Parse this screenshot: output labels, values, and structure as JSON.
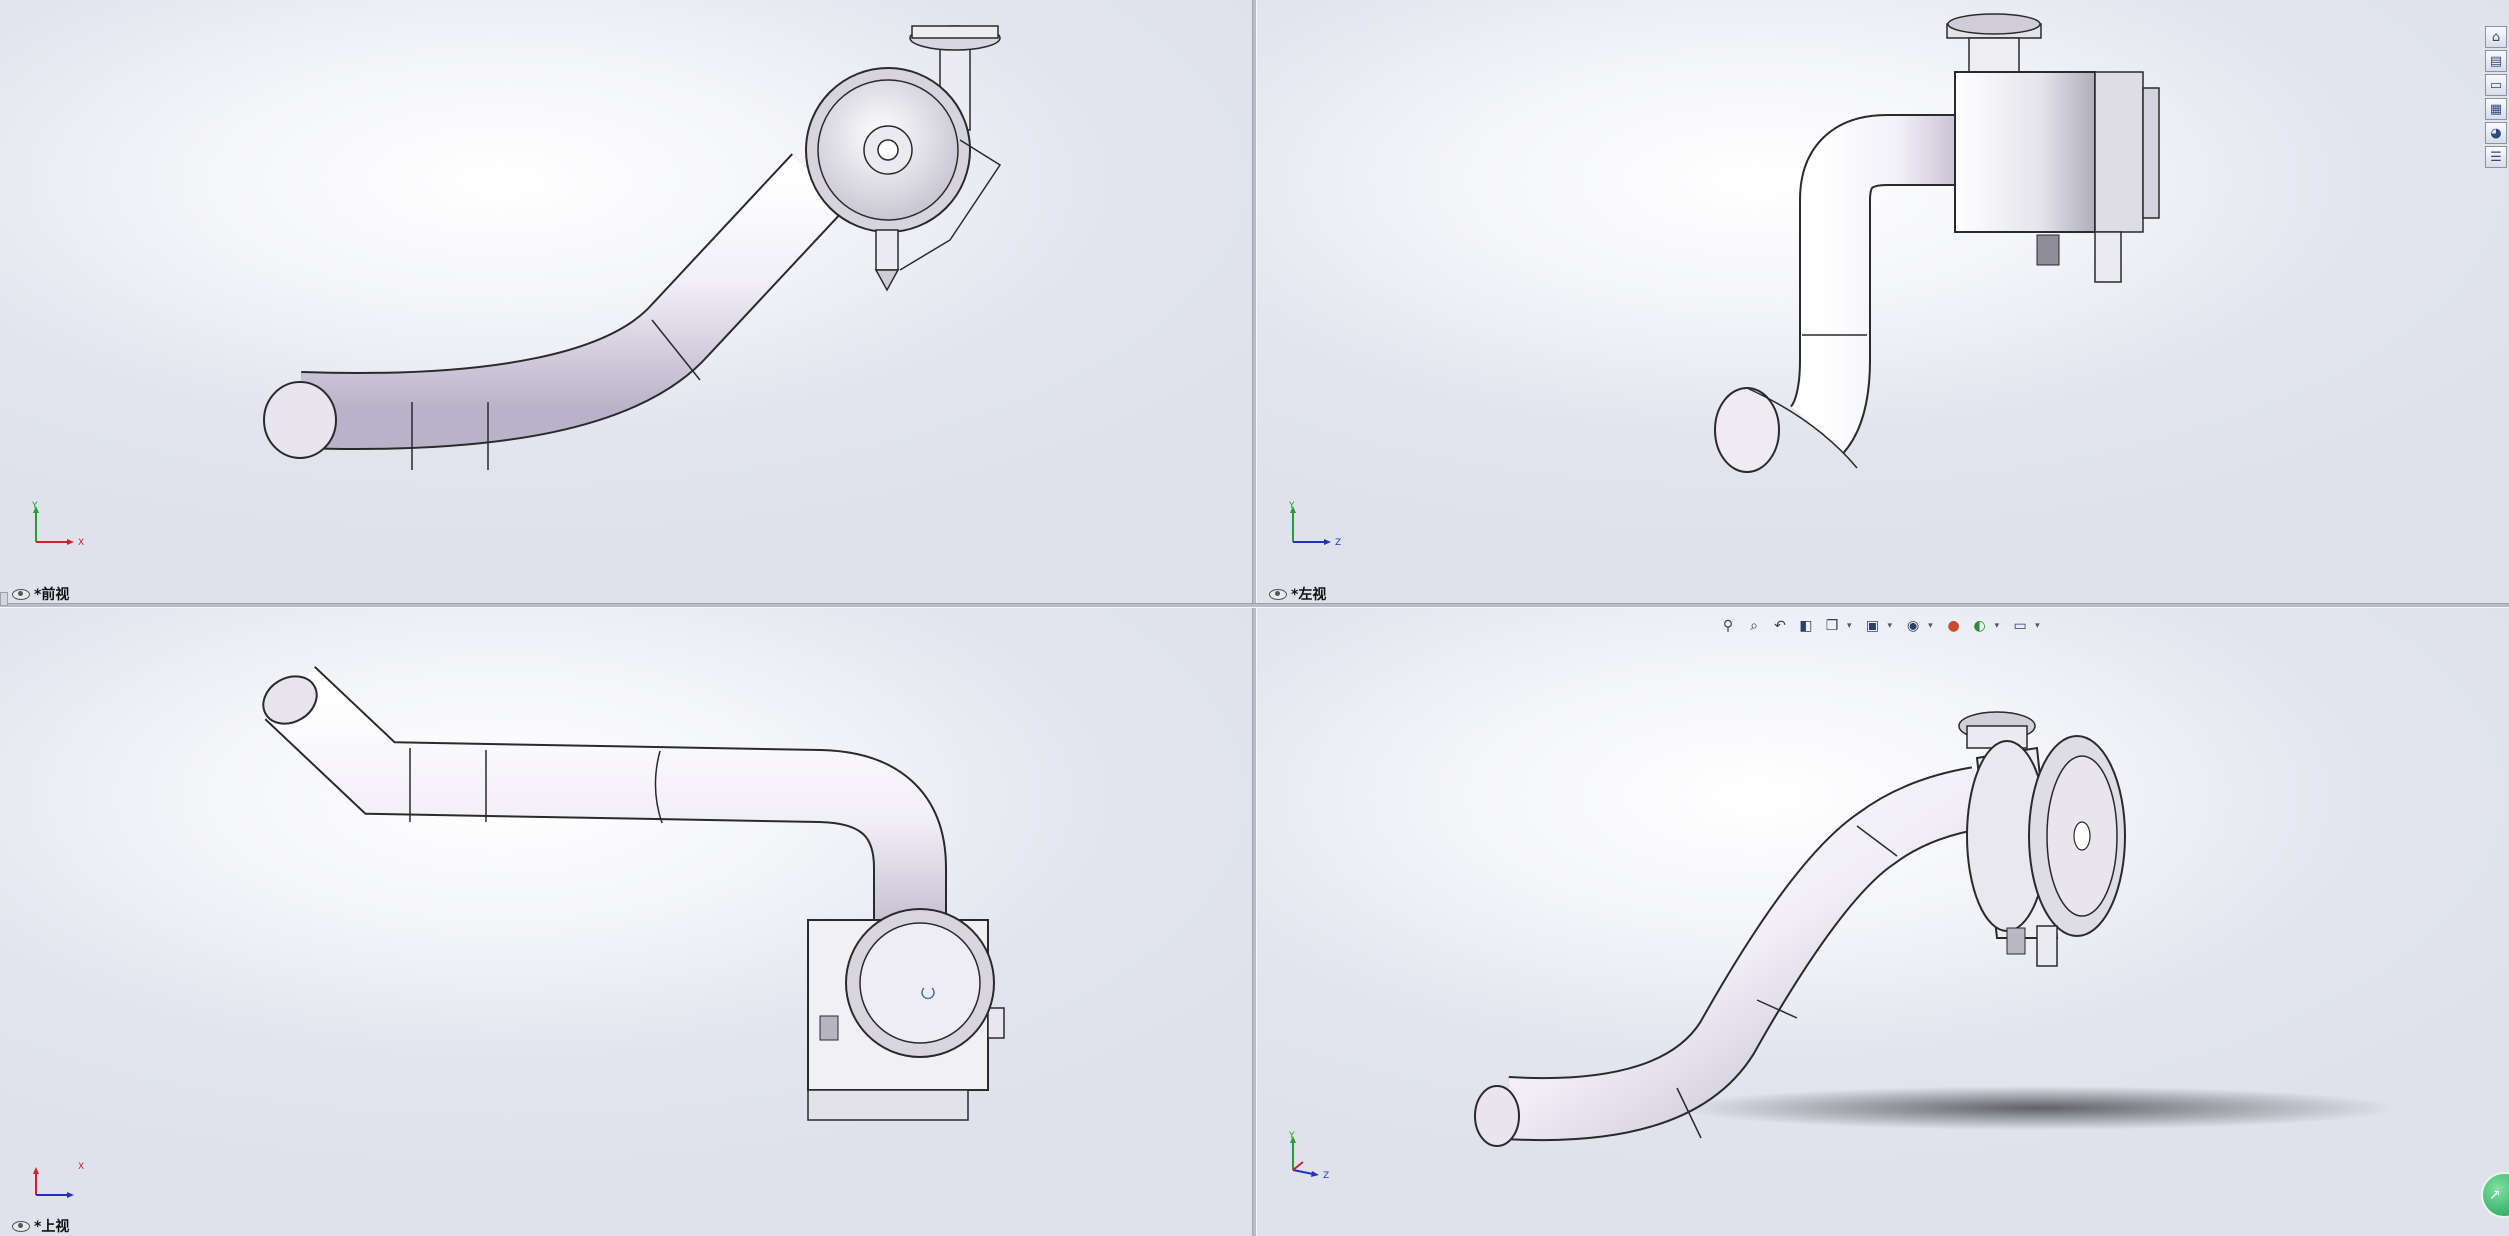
{
  "viewports": {
    "front": {
      "label": "*前视"
    },
    "left": {
      "label": "*左视"
    },
    "top": {
      "label": "*上视"
    },
    "iso": {
      "label": ""
    }
  },
  "triads": {
    "front": {
      "axis_h": "X",
      "axis_v": "Y"
    },
    "left": {
      "axis_h": "Z",
      "axis_v": "Y"
    },
    "top": {
      "axis_h": "X",
      "axis_v": ""
    },
    "iso": {
      "axis_h": "Z",
      "axis_v": "Y"
    }
  },
  "heads_up_toolbar": {
    "icons": [
      "zoom-to-fit-icon",
      "zoom-to-area-icon",
      "previous-view-icon",
      "section-view-icon",
      "view-orientation-icon",
      "display-style-icon",
      "hide-show-items-icon",
      "edit-appearance-icon",
      "apply-scene-icon",
      "view-settings-icon"
    ]
  },
  "task_pane": {
    "icons": [
      "home-icon",
      "design-library-icon",
      "file-explorer-icon",
      "view-palette-icon",
      "appearances-icon",
      "custom-properties-icon"
    ]
  },
  "colors": {
    "pipe_light": "#f6f4fb",
    "pipe_shade": "#bdb6cc",
    "outline": "#2a2a2a",
    "axis_x": "#d0202a",
    "axis_y": "#22a035",
    "axis_z": "#2233bb"
  }
}
